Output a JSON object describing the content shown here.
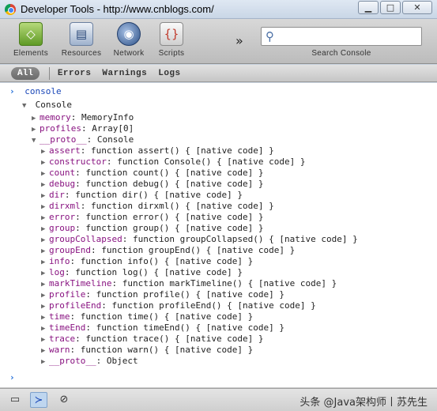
{
  "window": {
    "title": "Developer Tools - http://www.cnblogs.com/",
    "minimize_glyph": "▁",
    "maximize_glyph": "□",
    "close_glyph": "✕"
  },
  "toolbar": {
    "tools": [
      {
        "label": "Elements",
        "icon": "elements-icon",
        "glyph": "◇"
      },
      {
        "label": "Resources",
        "icon": "resources-icon",
        "glyph": "▤"
      },
      {
        "label": "Network",
        "icon": "network-icon",
        "glyph": "◉"
      },
      {
        "label": "Scripts",
        "icon": "scripts-icon",
        "glyph": "{}"
      }
    ],
    "more_glyph": "»",
    "search": {
      "label": "Search Console",
      "value": "",
      "glyph": "⚲"
    }
  },
  "filters": {
    "items": [
      "All",
      "Errors",
      "Warnings",
      "Logs"
    ],
    "selected": "All"
  },
  "console": {
    "command": "console",
    "object_label": "Console",
    "entries": [
      {
        "key": "memory",
        "sep": ": ",
        "value": "MemoryInfo"
      },
      {
        "key": "profiles",
        "sep": ": ",
        "value": "Array[0]"
      },
      {
        "key": "__proto__",
        "sep": ": ",
        "value": "Console"
      }
    ],
    "proto_members": [
      {
        "key": "assert",
        "value": "function assert() { [native code] }"
      },
      {
        "key": "constructor",
        "value": "function Console() { [native code] }"
      },
      {
        "key": "count",
        "value": "function count() { [native code] }"
      },
      {
        "key": "debug",
        "value": "function debug() { [native code] }"
      },
      {
        "key": "dir",
        "value": "function dir() { [native code] }"
      },
      {
        "key": "dirxml",
        "value": "function dirxml() { [native code] }"
      },
      {
        "key": "error",
        "value": "function error() { [native code] }"
      },
      {
        "key": "group",
        "value": "function group() { [native code] }"
      },
      {
        "key": "groupCollapsed",
        "value": "function groupCollapsed() { [native code] }"
      },
      {
        "key": "groupEnd",
        "value": "function groupEnd() { [native code] }"
      },
      {
        "key": "info",
        "value": "function info() { [native code] }"
      },
      {
        "key": "log",
        "value": "function log() { [native code] }"
      },
      {
        "key": "markTimeline",
        "value": "function markTimeline() { [native code] }"
      },
      {
        "key": "profile",
        "value": "function profile() { [native code] }"
      },
      {
        "key": "profileEnd",
        "value": "function profileEnd() { [native code] }"
      },
      {
        "key": "time",
        "value": "function time() { [native code] }"
      },
      {
        "key": "timeEnd",
        "value": "function timeEnd() { [native code] }"
      },
      {
        "key": "trace",
        "value": "function trace() { [native code] }"
      },
      {
        "key": "warn",
        "value": "function warn() { [native code] }"
      },
      {
        "key": "__proto__",
        "value": "Object"
      }
    ],
    "prompt_glyph": "›",
    "expanded_glyph": "▼",
    "collapsed_glyph": "▶"
  },
  "statusbar": {
    "dock_glyph": "▭",
    "console_glyph": "≻",
    "clear_glyph": "⊘",
    "watermark": "头条 @Java架构师丨苏先生"
  }
}
